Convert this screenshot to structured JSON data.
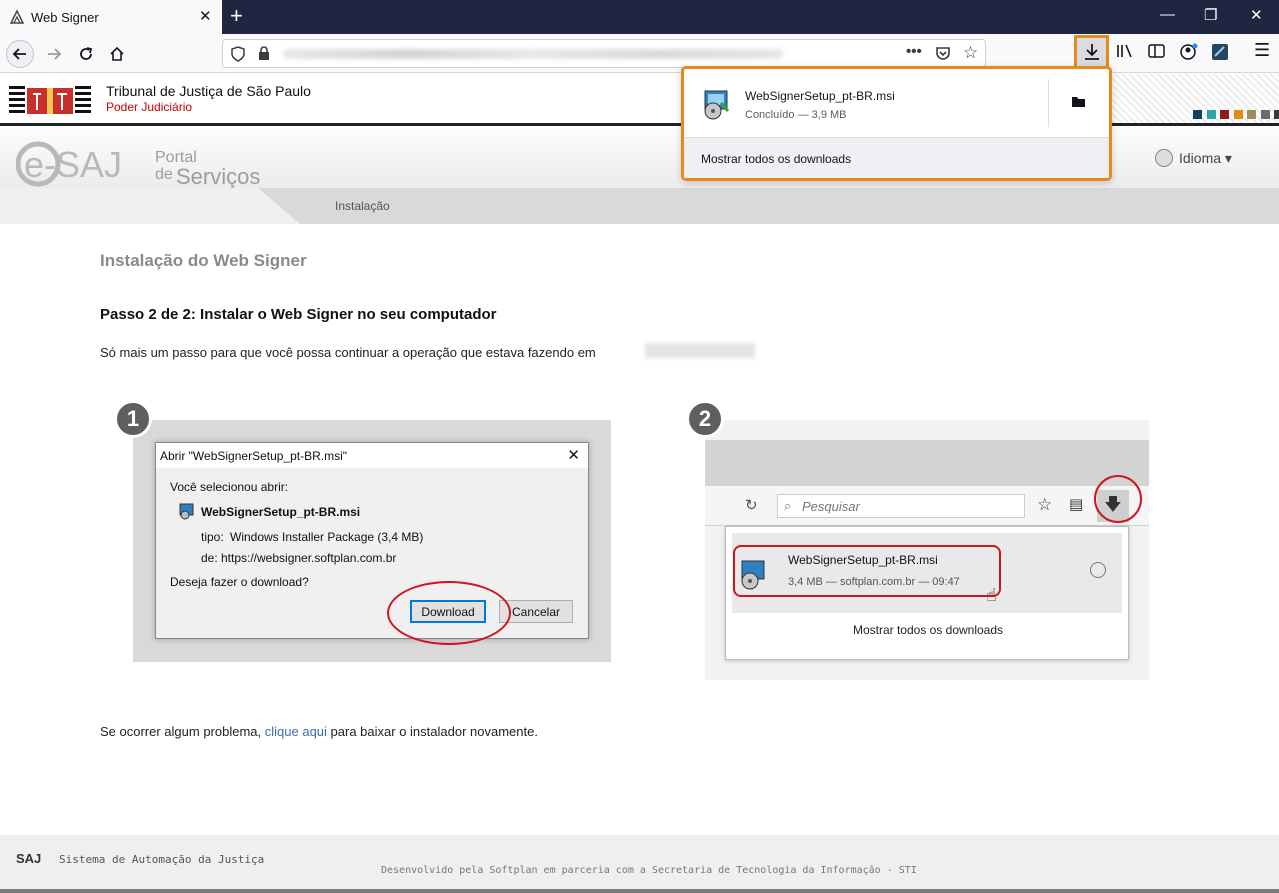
{
  "browser": {
    "tab_title": "Web Signer",
    "new_tab": "+",
    "close_tab": "✕",
    "win_min": "—",
    "win_restore": "❐",
    "win_close": "✕"
  },
  "header": {
    "tj_name": "Tribunal de Justiça de São Paulo",
    "tj_sub": "Poder Judiciário",
    "portal_line1": "Portal",
    "portal_line2": "de",
    "portal_line3": "Serviços",
    "esaj_logo": "e-SAJ",
    "help_mark": "?",
    "idioma": "Idioma ▾",
    "menu_item": "Instalação",
    "accent_colors": [
      "#173f5f",
      "#2ea3a8",
      "#8e1a1f",
      "#e38b1c",
      "#9a8f5a",
      "#6b6b6b",
      "#3a3a3a"
    ]
  },
  "download_panel": {
    "filename": "WebSignerSetup_pt-BR.msi",
    "status": "Concluído — 3,9 MB",
    "show_all": "Mostrar todos os downloads"
  },
  "content": {
    "title": "Instalação do Web Signer",
    "step_title": "Passo 2 de 2: Instalar o Web Signer no seu computador",
    "step_desc": "Só mais um passo para que você possa continuar a operação que estava fazendo em",
    "bottom_prefix": "Se ocorrer algum problema,",
    "bottom_link": "clique aqui",
    "bottom_suffix": "para baixar o instalador novamente."
  },
  "illustration1": {
    "badge": "1",
    "dialog_title": "Abrir \"WebSignerSetup_pt-BR.msi\"",
    "selected": "Você selecionou abrir:",
    "filename": "WebSignerSetup_pt-BR.msi",
    "tipo_label": "tipo:",
    "tipo_value": "Windows Installer Package (3,4 MB)",
    "de_label": "de:",
    "de_value": "https://websigner.softplan.com.br",
    "question": "Deseja fazer o download?",
    "download_btn": "Download",
    "cancel_btn": "Cancelar"
  },
  "illustration2": {
    "badge": "2",
    "search_placeholder": "Pesquisar",
    "filename": "WebSignerSetup_pt-BR.msi",
    "meta": "3,4 MB — softplan.com.br — 09:47",
    "show_all": "Mostrar todos os downloads"
  },
  "footer": {
    "saj": "SAJ",
    "sistema": "Sistema de Automação da Justiça",
    "developed": "Desenvolvido pela Softplan em parceria com a Secretaria de Tecnologia da Informação - STI"
  }
}
